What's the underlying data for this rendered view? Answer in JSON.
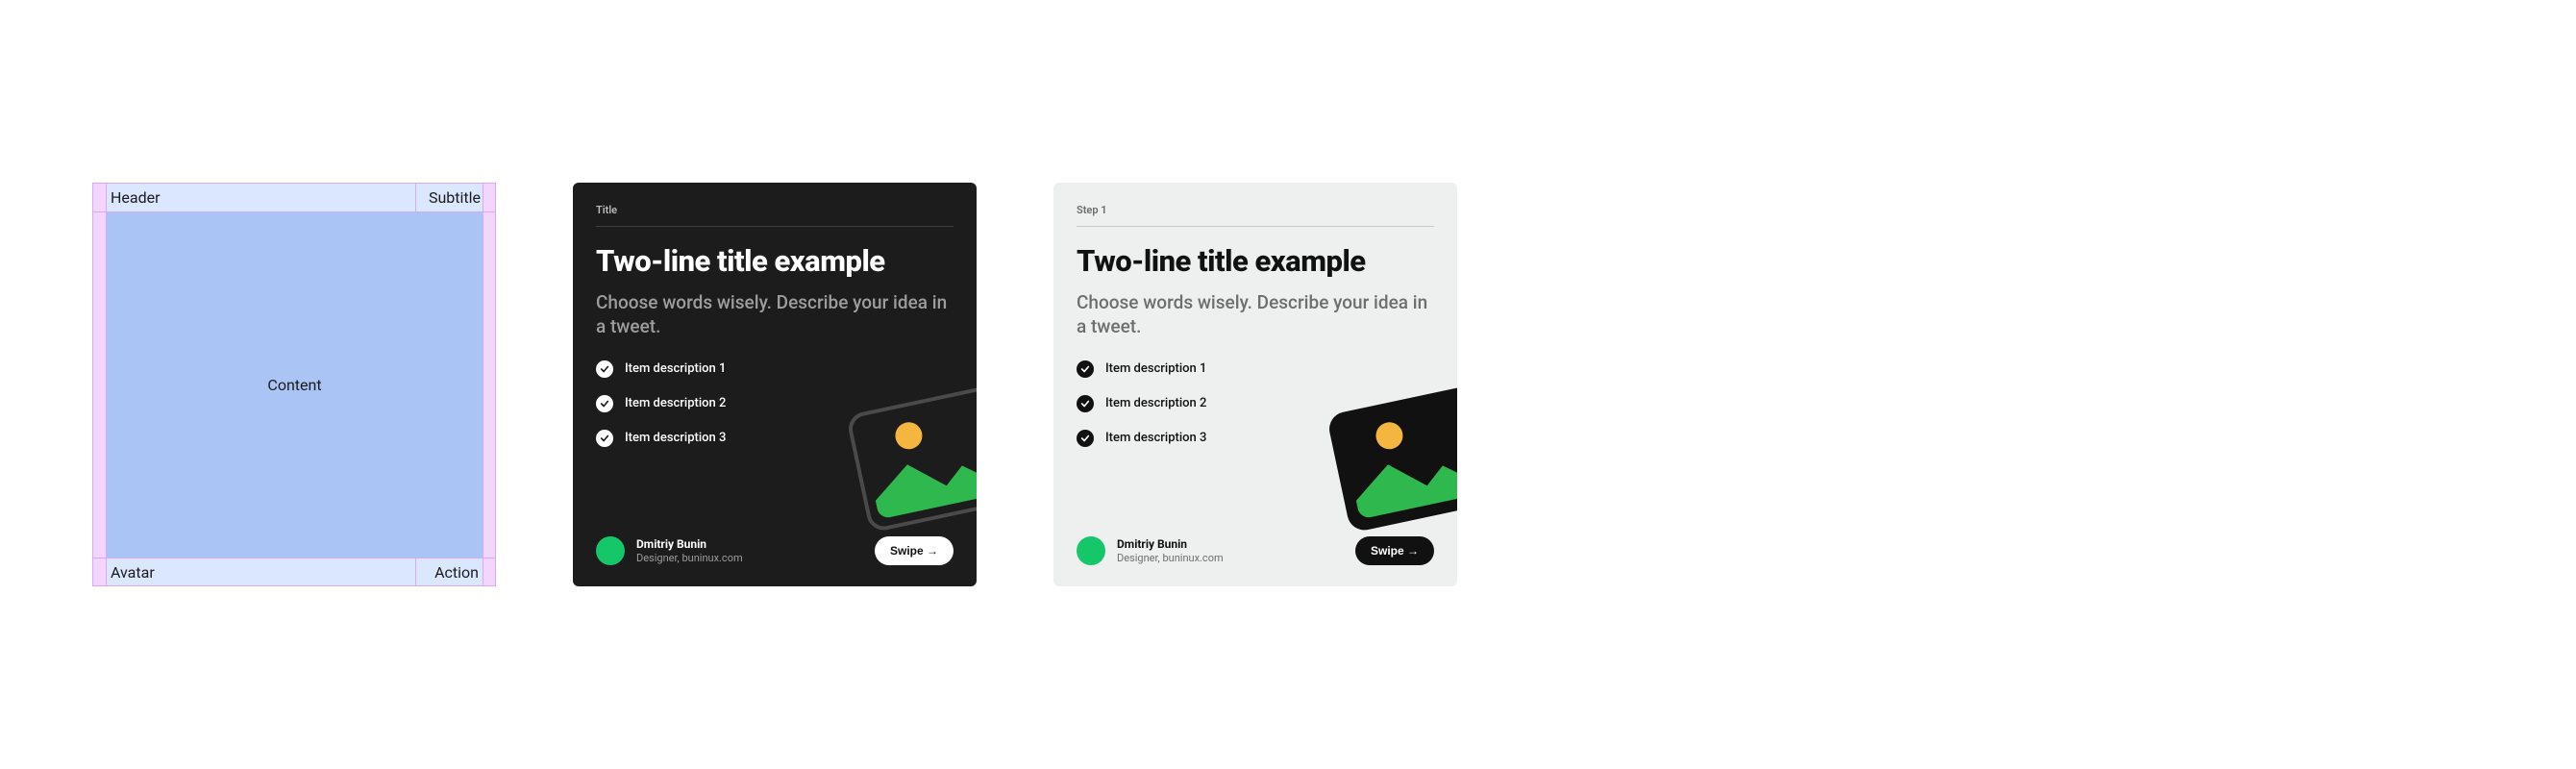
{
  "wireframe": {
    "header": "Header",
    "subtitle": "Subtitle",
    "content": "Content",
    "avatar": "Avatar",
    "action": "Action"
  },
  "cards": [
    {
      "topline": "Title",
      "title": "Two-line title example",
      "lede": "Choose words wisely. Describe your idea in a tweet.",
      "items": [
        "Item description 1",
        "Item description 2",
        "Item description 3"
      ],
      "author_name": "Dmitriy Bunin",
      "author_role": "Designer, buninux.com",
      "cta": "Swipe →",
      "theme": "dark"
    },
    {
      "topline": "Step 1",
      "title": "Two-line title example",
      "lede": "Choose words wisely. Describe your idea in a tweet.",
      "items": [
        "Item description 1",
        "Item description 2",
        "Item description 3"
      ],
      "author_name": "Dmitriy Bunin",
      "author_role": "Designer, buninux.com",
      "cta": "Swipe →",
      "theme": "light"
    }
  ],
  "colors": {
    "accent_green": "#16c76a",
    "sun": "#f4b63f",
    "hill": "#2fb84d",
    "dark_bg": "#1c1c1c",
    "light_bg": "#eef0ef"
  }
}
